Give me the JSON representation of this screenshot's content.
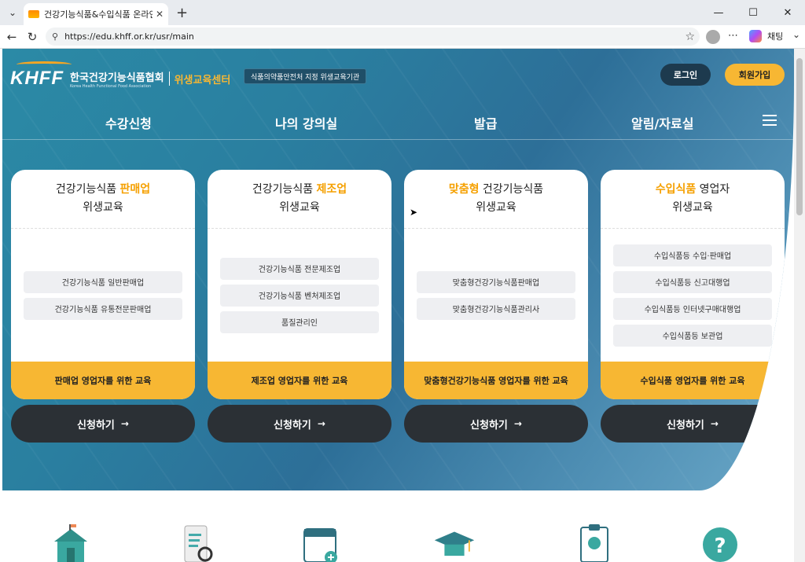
{
  "browser": {
    "tab_title": "건강기능식품&수입식품 온라인 위",
    "url": "https://edu.khff.or.kr/usr/main",
    "chat_label": "채팅",
    "tab_list_icon": "chevron-down-icon",
    "new_tab_icon": "plus-icon"
  },
  "header": {
    "logo_mark": "KHFF",
    "org_name_kr": "한국건강기능식품협회",
    "org_name_en": "Korea Health Functional Food Association",
    "center_name": "위생교육센터",
    "designation_badge": "식품의약품안전처 지정 위생교육기관",
    "login_label": "로그인",
    "join_label": "회원가입",
    "accent_color": "#f7b733"
  },
  "gnb": {
    "items": [
      "수강신청",
      "나의 강의실",
      "발급",
      "알림/자료실"
    ]
  },
  "cards": [
    {
      "title_pre": "건강기능식품 ",
      "title_hl": "판매업",
      "title_post": "",
      "subtitle": "위생교육",
      "options": [
        "건강기능식품 일반판매업",
        "건강기능식품 유통전문판매업"
      ],
      "footer": "판매업 영업자를 위한 교육",
      "apply_label": "신청하기"
    },
    {
      "title_pre": "건강기능식품 ",
      "title_hl": "제조업",
      "title_post": "",
      "subtitle": "위생교육",
      "options": [
        "건강기능식품 전문제조업",
        "건강기능식품 벤처제조업",
        "품질관리인"
      ],
      "footer": "제조업 영업자를 위한 교육",
      "apply_label": "신청하기"
    },
    {
      "title_pre": "",
      "title_hl": "맞춤형",
      "title_post": " 건강기능식품",
      "subtitle": "위생교육",
      "options": [
        "맞춤형건강기능식품판매업",
        "맞춤형건강기능식품관리사"
      ],
      "footer": "맞춤형건강기능식품 영업자를 위한 교육",
      "apply_label": "신청하기"
    },
    {
      "title_pre": "",
      "title_hl": "수입식품",
      "title_post": " 영업자",
      "subtitle": "위생교육",
      "options": [
        "수입식품등 수입·판매업",
        "수입식품등 신고대행업",
        "수입식품등 인터넷구매대행업",
        "수입식품등 보관업"
      ],
      "footer": "수입식품 영업자를 위한 교육",
      "apply_label": "신청하기"
    }
  ],
  "quick_icons": [
    "school-icon",
    "document-search-icon",
    "calendar-add-icon",
    "graduation-cap-icon",
    "report-clipboard-icon",
    "help-question-icon"
  ]
}
